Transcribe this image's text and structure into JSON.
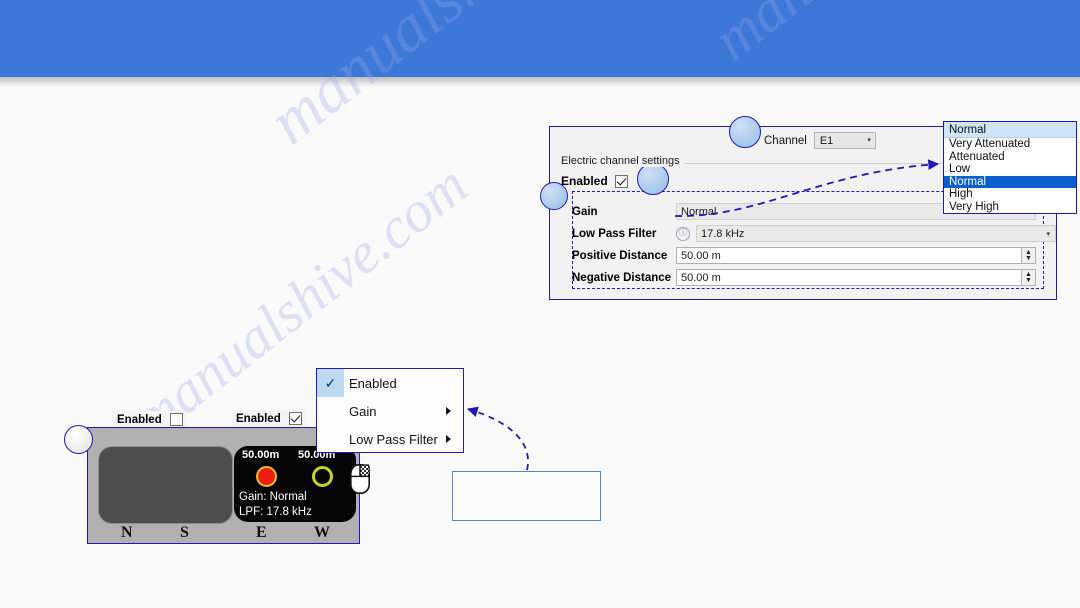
{
  "banner": {
    "color": "#3b78d8"
  },
  "watermark": {
    "text": "manualshive.com"
  },
  "settings_panel": {
    "channel": {
      "label": "Channel",
      "value": "E1",
      "chevron": "▾"
    },
    "group_title": "Electric channel settings",
    "enabled": {
      "label": "Enabled",
      "checked": true
    },
    "fields": [
      {
        "name": "Gain",
        "value": "Normal",
        "control": "readonly",
        "info": false
      },
      {
        "name": "Low Pass Filter",
        "value": "17.8 kHz",
        "control": "dropdown",
        "info": true,
        "info_glyph": "ⓘ"
      },
      {
        "name": "Positive Distance",
        "value": "50.00 m",
        "control": "spinner",
        "info": false
      },
      {
        "name": "Negative Distance",
        "value": "50.00 m",
        "control": "spinner",
        "info": false
      }
    ],
    "spin_up": "▲",
    "spin_down": "▼",
    "dd_chevron": "▾"
  },
  "gain_dropdown": {
    "header": "Normal",
    "items": [
      {
        "label": "Very Attenuated",
        "selected": false
      },
      {
        "label": "Attenuated",
        "selected": false
      },
      {
        "label": "Low",
        "selected": false
      },
      {
        "label": "Normal",
        "selected": true
      },
      {
        "label": "High",
        "selected": false
      },
      {
        "label": "Very High",
        "selected": false
      }
    ]
  },
  "context_menu": {
    "items": [
      {
        "label": "Enabled",
        "checked": true,
        "check_glyph": "✓",
        "submenu": false
      },
      {
        "label": "Gain",
        "checked": false,
        "check_glyph": "",
        "submenu": true
      },
      {
        "label": "Low Pass Filter",
        "checked": false,
        "check_glyph": "",
        "submenu": true
      }
    ]
  },
  "note_box": {
    "text": ""
  },
  "compass_widget": {
    "enabled_left": {
      "label": "Enabled",
      "checked": false
    },
    "enabled_right": {
      "label": "Enabled",
      "checked": true
    },
    "distance_left": "50.00m",
    "distance_right": "50.00m",
    "gain_text": "Gain: Normal",
    "lpf_text": "LPF: 17.8 kHz",
    "directions": {
      "n": "N",
      "s": "S",
      "e": "E",
      "w": "W"
    }
  },
  "colors": {
    "banner_blue": "#3b78d8",
    "annotation_blue": "#2118b8",
    "highlight_blue": "#0a5fd0",
    "led_red": "#ee1c10",
    "led_yellow": "#c9d41e",
    "panel_gray": "#f2f2f2",
    "widget_gray": "#b1b1b1"
  }
}
